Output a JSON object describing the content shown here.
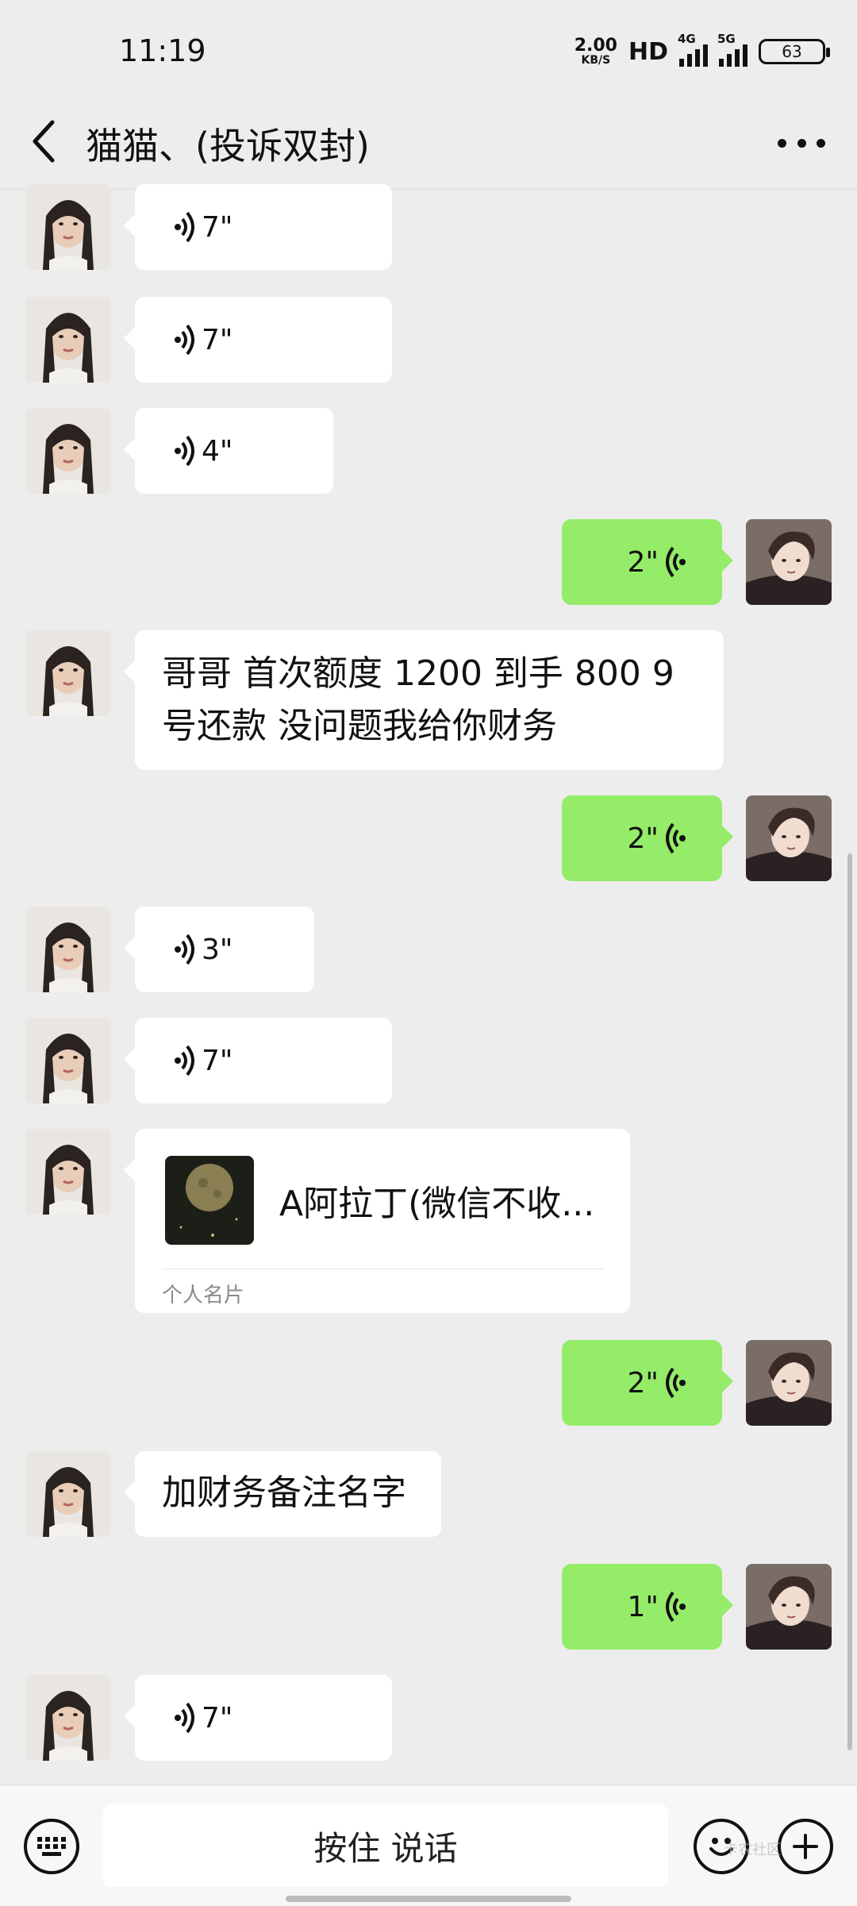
{
  "status_bar": {
    "time": "11:19",
    "net_speed_value": "2.00",
    "net_speed_unit": "KB/S",
    "hd_label": "HD",
    "sim1_network": "4G",
    "sim2_network": "5G",
    "battery_level": "63"
  },
  "header": {
    "title": "猫猫、(投诉双封)"
  },
  "messages": [
    {
      "side": "left",
      "type": "voice",
      "duration": "7\""
    },
    {
      "side": "left",
      "type": "voice",
      "duration": "7\""
    },
    {
      "side": "left",
      "type": "voice",
      "duration": "4\""
    },
    {
      "side": "right",
      "type": "voice",
      "duration": "2\""
    },
    {
      "side": "left",
      "type": "text",
      "lines": [
        "哥哥  首次额度 1200 到手 800   9",
        "号还款   没问题我给你财务"
      ]
    },
    {
      "side": "right",
      "type": "voice",
      "duration": "2\""
    },
    {
      "side": "left",
      "type": "voice",
      "duration": "3\""
    },
    {
      "side": "left",
      "type": "voice",
      "duration": "7\""
    },
    {
      "side": "left",
      "type": "card",
      "name": "A阿拉丁(微信不收...",
      "label": "个人名片"
    },
    {
      "side": "right",
      "type": "voice",
      "duration": "2\""
    },
    {
      "side": "left",
      "type": "text",
      "lines": [
        "加财务备注名字"
      ]
    },
    {
      "side": "right",
      "type": "voice",
      "duration": "1\""
    },
    {
      "side": "left",
      "type": "voice",
      "duration": "7\""
    }
  ],
  "input_bar": {
    "hold_to_talk": "按住 说话",
    "keyboard_icon": "keyboard-icon",
    "emoji_icon": "emoji-icon",
    "plus_icon": "plus-icon"
  },
  "watermark": "卡农社区",
  "colors": {
    "background": "#ededed",
    "bubble_received": "#ffffff",
    "bubble_sent": "#95ec69"
  }
}
